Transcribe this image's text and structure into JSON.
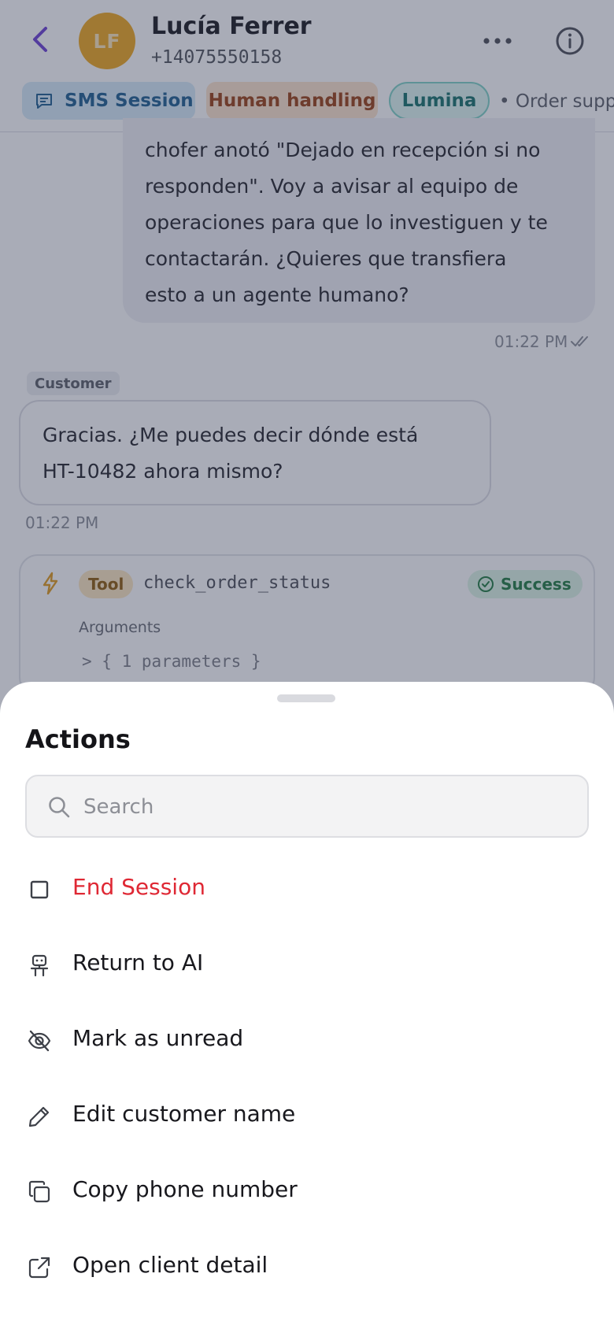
{
  "header": {
    "avatar_initials": "LF",
    "contact_name": "Lucía Ferrer",
    "contact_phone": "+14075550158"
  },
  "chips": {
    "sms": "SMS Session",
    "human": "Human handling",
    "lumina": "Lumina",
    "order": "• Order support"
  },
  "messages": {
    "ai_lines": [
      "chofer anotó \"Dejado en recepción si no",
      "responden\". Voy a avisar al equipo de",
      "operaciones para que lo investiguen y te",
      "contactarán. ¿Quieres que transfiera",
      "esto a un agente humano?"
    ],
    "ai_time": "01:22 PM",
    "customer_role": "Customer",
    "customer_lines": [
      "Gracias. ¿Me puedes decir dónde está",
      "HT-10482 ahora mismo?"
    ],
    "customer_time": "01:22 PM"
  },
  "tool": {
    "tag": "Tool",
    "name": "check_order_status",
    "status": "Success",
    "args_label": "Arguments",
    "args_value": "> { 1 parameters }"
  },
  "sheet": {
    "title": "Actions",
    "search_placeholder": "Search",
    "actions": [
      {
        "label": "End Session",
        "icon": "stop-square-icon"
      },
      {
        "label": "Return to AI",
        "icon": "robot-icon"
      },
      {
        "label": "Mark as unread",
        "icon": "eye-off-icon"
      },
      {
        "label": "Edit customer name",
        "icon": "pencil-icon"
      },
      {
        "label": "Copy phone number",
        "icon": "copy-icon"
      },
      {
        "label": "Open client detail",
        "icon": "external-link-icon"
      }
    ]
  },
  "colors": {
    "accent": "#6b3fd4",
    "danger": "#df2834",
    "avatar": "#f0a81c",
    "overlay": "#323a54"
  }
}
